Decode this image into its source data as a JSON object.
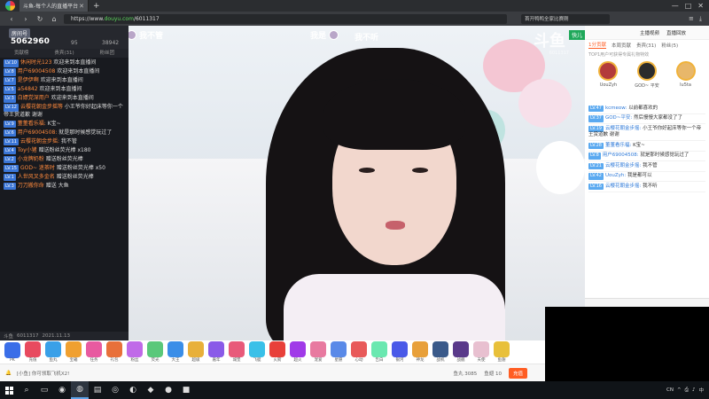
{
  "browser": {
    "tab_title": "斗鱼-每个人的直播平台",
    "new_tab": "+",
    "url_prefix": "https://www.",
    "url_host": "douyu.com",
    "url_path": "/6011317",
    "search_placeholder": "首开鸭鸭全家比赛刚",
    "window_controls": [
      "—",
      "□",
      "✕"
    ]
  },
  "left_panel": {
    "room_badge": "房间号",
    "room_number": "5062960",
    "stat_a": "95",
    "stat_b": "38942",
    "tabs": [
      "贡献榜",
      "贵宾(31)",
      "粉丝团"
    ],
    "messages": [
      {
        "level": "LV.10",
        "user": "休闲时光123",
        "text": "欢迎来到本直播间"
      },
      {
        "level": "LV.8",
        "user": "用户69004508",
        "text": "欢迎来到本直播间"
      },
      {
        "level": "LV.7",
        "user": "是伊伊啊",
        "text": "欢迎来到本直播间"
      },
      {
        "level": "LV.5",
        "user": "a54842",
        "text": "欢迎来到本直播间"
      },
      {
        "level": "LV.3",
        "user": "白嫖党深用户",
        "text": "欢迎来到本直播间"
      },
      {
        "level": "LV.12",
        "user": "云樱花朝金步摇等",
        "text": "小王爷你好起床等你一个帝王赏道歉 谢谢"
      },
      {
        "level": "LV.9",
        "user": "董董看乐福:",
        "text": "K宝~"
      },
      {
        "level": "LV.6",
        "user": "用户69004508:",
        "text": "就是那时候感觉玩过了"
      },
      {
        "level": "LV.11",
        "user": "云樱花朝金步摇:",
        "text": "我不管"
      },
      {
        "level": "LV.4",
        "user": "Toy小猪",
        "text": "赠送粉丝荧光棒 x180"
      },
      {
        "level": "LV.2",
        "user": "小龙牌奶粉",
        "text": "赠送粉丝荧光棒"
      },
      {
        "level": "LV.15",
        "user": "GOD~ 迷茶时",
        "text": "赠送粉丝荧光棒 x50"
      },
      {
        "level": "LV.1",
        "user": "人世风叉多金名",
        "text": "赠送粉丝荧光棒"
      },
      {
        "level": "LV.3",
        "user": "刀刀搬你命",
        "text": "赠送 大鱼"
      }
    ],
    "footer_a": "斗鱼",
    "footer_b": "6011317",
    "footer_c": "2021.11.13"
  },
  "video": {
    "danmu_1": "我不管",
    "danmu_2": "我是",
    "danmu_3": "我不听",
    "watermark": "斗鱼",
    "watermark_id": "6011317",
    "green_tag": "快儿"
  },
  "right_panel": {
    "top_links": [
      "主播视频",
      "直播回放"
    ],
    "tabs": [
      "1分贡献",
      "本周贡献",
      "贵宾(31)",
      "粉丝(5)"
    ],
    "note": "TOP1用户可获得专属礼物特效",
    "podium": [
      {
        "name": "UouZyh",
        "color": "#b33b3b"
      },
      {
        "name": "GOD~ 平安",
        "color": "#2c2c2c"
      },
      {
        "name": "lu5ta",
        "color": "#e8b76a"
      }
    ],
    "messages": [
      {
        "level": "LV.47",
        "user": "kcmeow:",
        "text": "以前都喜欢的"
      },
      {
        "level": "LV.37",
        "user": "GOD~平安:",
        "text": "然后慢慢大家都没了了"
      },
      {
        "level": "LV.19",
        "user": "云樱花朝金步摇:",
        "text": "小王爷你好起床等你一个帝王赏道歉 谢谢"
      },
      {
        "level": "LV.28",
        "user": "董董看乐福:",
        "text": "K宝~"
      },
      {
        "level": "LV.8",
        "user": "用户69004508:",
        "text": "就是那时候感觉玩过了"
      },
      {
        "level": "LV.21",
        "user": "云樱花朝金步摇:",
        "text": "我不管"
      },
      {
        "level": "LV.42",
        "user": "UouZyh:",
        "text": "我是都可以"
      },
      {
        "level": "LV.16",
        "user": "云樱花朝金步摇:",
        "text": "我不听"
      }
    ]
  },
  "gifts": [
    {
      "label": "PK",
      "color": "#3a6ee8"
    },
    {
      "label": "充值",
      "color": "#e84a5f"
    },
    {
      "label": "鱼丸",
      "color": "#3aa0e8"
    },
    {
      "label": "宝箱",
      "color": "#f0a030"
    },
    {
      "label": "任务",
      "color": "#e85aa0"
    },
    {
      "label": "礼包",
      "color": "#e8703a"
    },
    {
      "label": "粉丝",
      "color": "#c06ae8"
    },
    {
      "label": "荧光",
      "color": "#5ac87a"
    },
    {
      "label": "大王",
      "color": "#3a8ee8"
    },
    {
      "label": "超级",
      "color": "#e8b03a"
    },
    {
      "label": "嘉年",
      "color": "#8a5ae8"
    },
    {
      "label": "城堡",
      "color": "#e85a7a"
    },
    {
      "label": "飞艇",
      "color": "#3ac0e8"
    },
    {
      "label": "火箭",
      "color": "#e8403a"
    },
    {
      "label": "超火",
      "color": "#a03ae8"
    },
    {
      "label": "宠爱",
      "color": "#e87aa0"
    },
    {
      "label": "星愿",
      "color": "#5a8ae8"
    },
    {
      "label": "心动",
      "color": "#e85a5a"
    },
    {
      "label": "告白",
      "color": "#6ae8b0"
    },
    {
      "label": "银河",
      "color": "#4a5ae8"
    },
    {
      "label": "神龙",
      "color": "#e8a03a"
    },
    {
      "label": "战机",
      "color": "#3a5a8a"
    },
    {
      "label": "战舰",
      "color": "#5a3a8a"
    },
    {
      "label": "天使",
      "color": "#e8c0d0"
    },
    {
      "label": "鱼翅",
      "color": "#e8c03a"
    }
  ],
  "giftfoot": {
    "left_text": "[小鱼] 你可领取飞机X2!",
    "balance_a": "鱼丸 3085",
    "balance_b": "鱼翅 10",
    "btn": "充值"
  },
  "taskbar": {
    "tray_lang": "CN",
    "tray_items": [
      "^",
      "⎙",
      "♪",
      "中"
    ]
  }
}
